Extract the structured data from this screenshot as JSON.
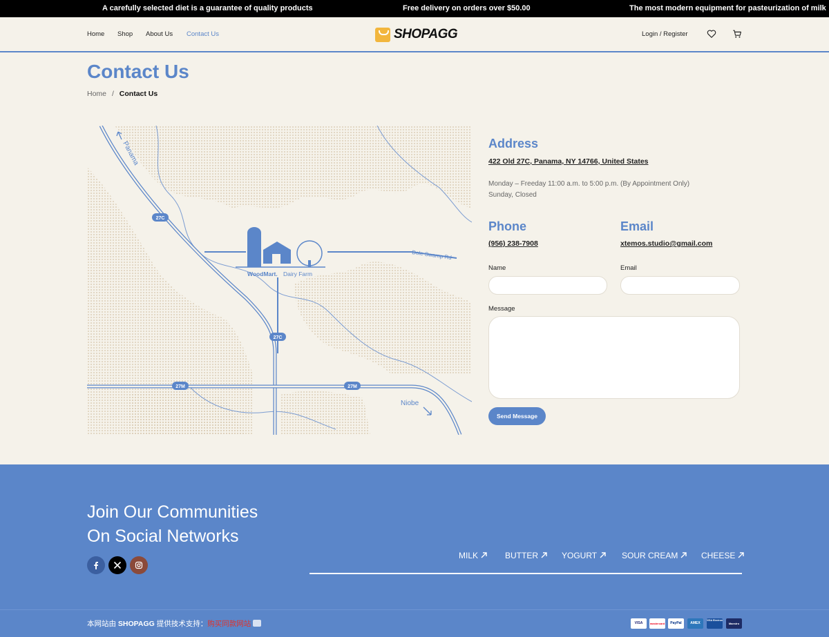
{
  "topbar": {
    "left": "A carefully selected diet is a guarantee of quality products",
    "center": "Free delivery on orders over $50.00",
    "right": "The most modern equipment for pasteurization of milk"
  },
  "header": {
    "nav": [
      {
        "label": "Home"
      },
      {
        "label": "Shop"
      },
      {
        "label": "About Us"
      },
      {
        "label": "Contact Us",
        "active": true
      }
    ],
    "logo_text": "SHOPAGG",
    "login_label": "Login / Register",
    "icons": [
      "heart-icon",
      "cart-icon"
    ]
  },
  "page": {
    "title": "Contact Us",
    "breadcrumb": {
      "home": "Home",
      "separator": "/",
      "current": "Contact Us"
    }
  },
  "map": {
    "labels": {
      "panama": "Panama",
      "dole_swamp": "Dole Swamp Rd",
      "niobe": "Niobe",
      "farm_brand": "WoodMart.",
      "farm_name": "Dairy Farm",
      "route_27c": "27C",
      "route_27m": "27M"
    }
  },
  "contact": {
    "address_heading": "Address",
    "address": "422 Old 27C, Panama, NY 14766, United States",
    "hours_line1": "Monday – Freeday 11:00 a.m. to 5:00 p.m. (By Appointment Only)",
    "hours_line2": "Sunday, Closed",
    "phone_heading": "Phone",
    "phone": "(956) 238-7908",
    "email_heading": "Email",
    "email": "xtemos.studio@gmail.com"
  },
  "form": {
    "name_label": "Name",
    "name_value": "",
    "email_label": "Email",
    "email_value": "",
    "message_label": "Message",
    "message_value": "",
    "submit_label": "Send Message"
  },
  "footer": {
    "title_line1": "Join Our Communities",
    "title_line2": "On Social Networks",
    "social": [
      "facebook-icon",
      "x-icon",
      "instagram-icon"
    ],
    "categories": [
      "MILK",
      "BUTTER",
      "YOGURT",
      "SOUR CREAM",
      "CHEESE"
    ],
    "copyright_prefix": "本网站由",
    "copyright_brand": "SHOPAGG",
    "copyright_mid": "提供技术支持：",
    "copyright_link": "购买同款网站",
    "payment": [
      "VISA",
      "mastercard",
      "PayPal",
      "AMEX",
      "VISA Electron",
      "Maestro"
    ]
  },
  "colors": {
    "accent": "#5b86c9",
    "background": "#f5f2ea",
    "topbar": "#000000",
    "logo": "#f2b63d"
  }
}
